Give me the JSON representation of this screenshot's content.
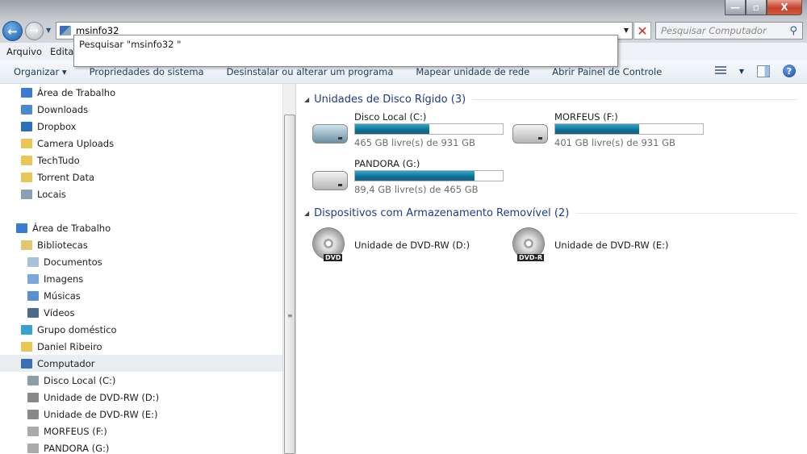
{
  "window": {
    "minimize": "—",
    "maximize": "▫",
    "close": "X"
  },
  "nav": {
    "address_value": "msinfo32",
    "search_placeholder": "Pesquisar Computador",
    "suggestion": "Pesquisar \"msinfo32 \""
  },
  "menu": [
    "Arquivo",
    "Editar"
  ],
  "toolbar": {
    "organize": "Organizar ▾",
    "items": [
      "Propriedades do sistema",
      "Desinstalar ou alterar um programa",
      "Mapear unidade de rede",
      "Abrir Painel de Controle"
    ],
    "help": "?"
  },
  "sidebar": {
    "items": [
      {
        "label": "Área de Trabalho",
        "indent": 1,
        "icon": "desktop-icon",
        "color": "#3a7bd5"
      },
      {
        "label": "Downloads",
        "indent": 1,
        "icon": "downloads-icon",
        "color": "#4a8ad0"
      },
      {
        "label": "Dropbox",
        "indent": 1,
        "icon": "dropbox-icon",
        "color": "#2a6fc0"
      },
      {
        "label": "Camera Uploads",
        "indent": 1,
        "icon": "folder-icon",
        "color": "#e8c65a"
      },
      {
        "label": "TechTudo",
        "indent": 1,
        "icon": "folder-icon",
        "color": "#e8c65a"
      },
      {
        "label": "Torrent Data",
        "indent": 1,
        "icon": "folder-icon",
        "color": "#e8c65a"
      },
      {
        "label": "Locais",
        "indent": 1,
        "icon": "places-icon",
        "color": "#8aa0b8"
      },
      {
        "label": "",
        "indent": 0,
        "icon": "",
        "color": ""
      },
      {
        "label": "Área de Trabalho",
        "indent": 0,
        "icon": "desktop-icon",
        "color": "#3a7bd5"
      },
      {
        "label": "Bibliotecas",
        "indent": 1,
        "icon": "libraries-icon",
        "color": "#e0c870"
      },
      {
        "label": "Documentos",
        "indent": 2,
        "icon": "documents-icon",
        "color": "#a8c0dc"
      },
      {
        "label": "Imagens",
        "indent": 2,
        "icon": "pictures-icon",
        "color": "#7aa8d8"
      },
      {
        "label": "Músicas",
        "indent": 2,
        "icon": "music-icon",
        "color": "#5a90d0"
      },
      {
        "label": "Vídeos",
        "indent": 2,
        "icon": "videos-icon",
        "color": "#4a6a8a"
      },
      {
        "label": "Grupo doméstico",
        "indent": 1,
        "icon": "homegroup-icon",
        "color": "#3aa0d0"
      },
      {
        "label": "Daniel Ribeiro",
        "indent": 1,
        "icon": "user-folder-icon",
        "color": "#e8c65a"
      },
      {
        "label": "Computador",
        "indent": 1,
        "icon": "computer-icon",
        "color": "#3a6fb8",
        "selected": true
      },
      {
        "label": "Disco Local (C:)",
        "indent": 2,
        "icon": "hdd-icon",
        "color": "#8aa0a8"
      },
      {
        "label": "Unidade de DVD-RW (D:)",
        "indent": 2,
        "icon": "dvd-icon",
        "color": "#888"
      },
      {
        "label": "Unidade de DVD-RW (E:)",
        "indent": 2,
        "icon": "dvd-icon",
        "color": "#888"
      },
      {
        "label": "MORFEUS (F:)",
        "indent": 2,
        "icon": "hdd-icon",
        "color": "#aaa"
      },
      {
        "label": "PANDORA (G:)",
        "indent": 2,
        "icon": "hdd-icon",
        "color": "#aaa"
      }
    ]
  },
  "content": {
    "hdd_group": "Unidades de Disco Rígido (3)",
    "removable_group": "Dispositivos com Armazenamento Removível (2)",
    "drives": [
      {
        "name": "Disco Local (C:)",
        "free": "465 GB livre(s) de 931 GB",
        "used_fraction": 0.5,
        "system": true
      },
      {
        "name": "MORFEUS (F:)",
        "free": "401 GB livre(s) de 931 GB",
        "used_fraction": 0.57
      },
      {
        "name": "PANDORA (G:)",
        "free": "89,4 GB livre(s) de 465 GB",
        "used_fraction": 0.81
      }
    ],
    "dvds": [
      {
        "name": "Unidade de DVD-RW (D:)",
        "badge": "DVD"
      },
      {
        "name": "Unidade de DVD-RW (E:)",
        "badge": "DVD-R"
      }
    ]
  }
}
